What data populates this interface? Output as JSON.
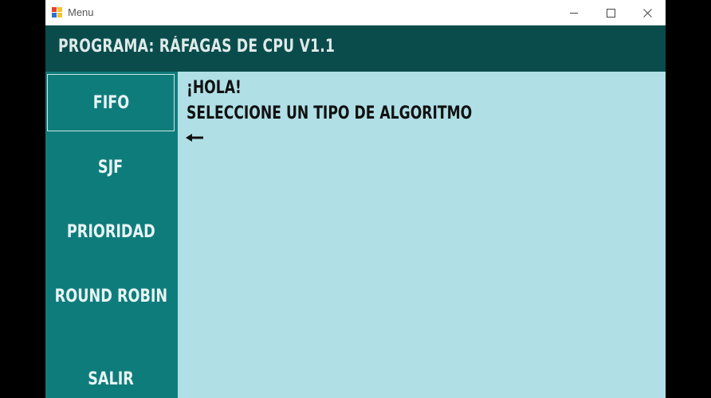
{
  "window": {
    "title": "Menu",
    "controls": {
      "minimize": "minimize",
      "maximize": "maximize",
      "close": "close"
    }
  },
  "header": {
    "title": "PROGRAMA: RÁFAGAS DE CPU V1.1"
  },
  "sidebar": {
    "items": [
      {
        "label": "FIFO",
        "active": true
      },
      {
        "label": "SJF",
        "active": false
      },
      {
        "label": "PRIORIDAD",
        "active": false
      },
      {
        "label": "ROUND ROBIN",
        "active": false
      },
      {
        "label": "SALIR",
        "active": false
      }
    ]
  },
  "content": {
    "greeting": "¡HOLA!",
    "instruction": "SELECCIONE UN TIPO DE ALGORITMO",
    "arrow_icon": "arrow-left-icon"
  },
  "colors": {
    "header_bg": "#0a4c4c",
    "sidebar_bg": "#0f7c7c",
    "content_bg": "#b0e0e6"
  }
}
